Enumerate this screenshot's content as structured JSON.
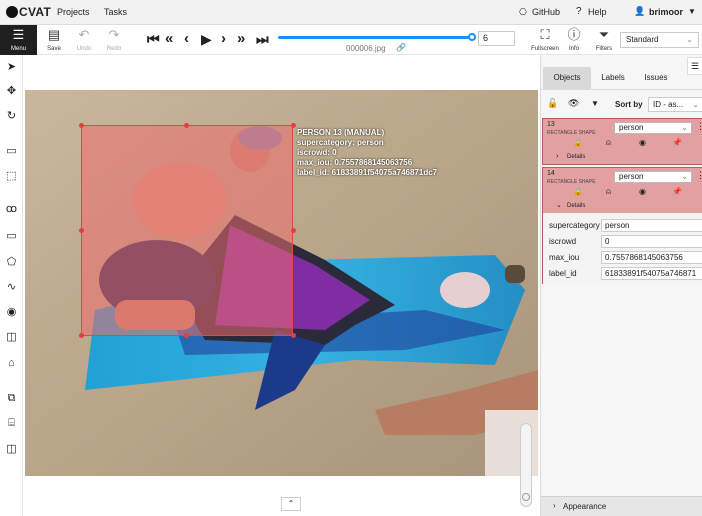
{
  "topbar": {
    "logo": "CVAT",
    "nav": [
      "Projects",
      "Tasks"
    ],
    "github": "GitHub",
    "help": "Help",
    "user": "brimoor"
  },
  "toolbar": {
    "menu": "Menu",
    "save": "Save",
    "undo": "Undo",
    "redo": "Redo",
    "frame_number": "6",
    "filename": "000006.jpg",
    "fullscreen": "Fullscreen",
    "info": "Info",
    "filters": "Filters",
    "workspace": "Standard"
  },
  "canvas": {
    "label_lines": [
      "PERSON 13 (MANUAL)",
      "supercategory: person",
      "iscrowd: 0",
      "max_iou: 0.7557868145063756",
      "label_id: 61833891f54075a746871dc7"
    ]
  },
  "sidebar": {
    "tabs": [
      "Objects",
      "Labels",
      "Issues"
    ],
    "sort_label": "Sort by",
    "sort_value": "ID - as...",
    "objects": [
      {
        "id": "13",
        "shape": "RECTANGLE SHAPE",
        "label": "person",
        "details": "Details"
      },
      {
        "id": "14",
        "shape": "RECTANGLE SHAPE",
        "label": "person",
        "details": "Details",
        "attributes": [
          {
            "key": "supercategory",
            "value": "person"
          },
          {
            "key": "iscrowd",
            "value": "0"
          },
          {
            "key": "max_iou",
            "value": "0.7557868145063756"
          },
          {
            "key": "label_id",
            "value": "61833891f54075a746871"
          }
        ]
      }
    ],
    "appearance": "Appearance"
  },
  "colors": {
    "accent": "#1890ff",
    "shape_fill": "#e88080",
    "card": "#e3a0a0"
  }
}
